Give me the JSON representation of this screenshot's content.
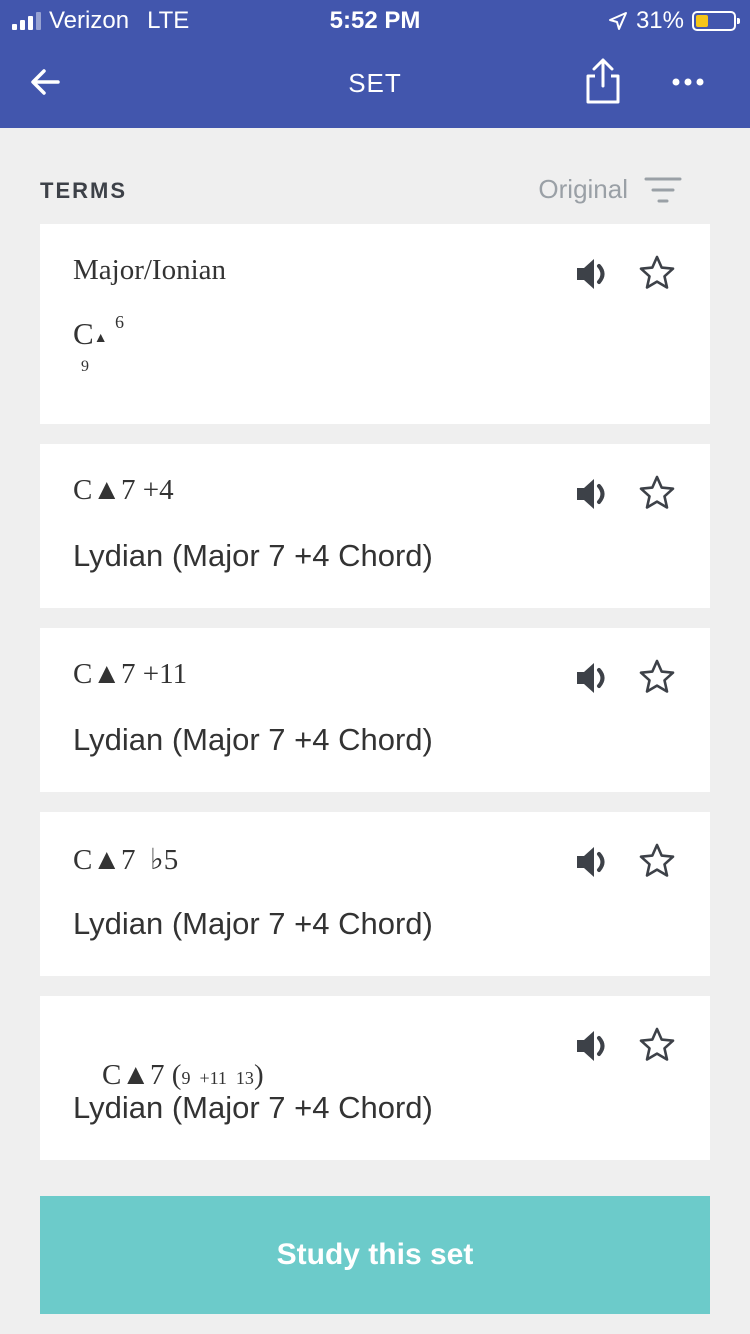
{
  "status_bar": {
    "carrier": "Verizon",
    "network": "LTE",
    "time": "5:52 PM",
    "battery": "31%",
    "battery_level": 0.31
  },
  "nav": {
    "title": "SET",
    "back_icon": "arrow-left-icon",
    "share_icon": "share-icon",
    "more_icon": "more-horizontal-icon"
  },
  "terms_section": {
    "label": "TERMS",
    "sort_label": "Original",
    "sort_icon": "filter-icon"
  },
  "cards": [
    {
      "term": "Major/Ionian",
      "definition_symbol": {
        "c": "C",
        "triangle": "▲",
        "sup": "6",
        "sub": "9"
      }
    },
    {
      "term": "C▲7 +4",
      "definition": "Lydian (Major 7 +4 Chord)"
    },
    {
      "term": "C▲7 +11",
      "definition": "Lydian (Major 7 +4 Chord)"
    },
    {
      "term": "C▲7  ♭5",
      "definition": "Lydian (Major 7 +4 Chord)"
    },
    {
      "term_parts": {
        "base": "C▲7 (",
        "inner": "9  +11  13",
        "close": ")"
      },
      "definition": "Lydian (Major 7 +4 Chord)"
    }
  ],
  "study_button": {
    "label": "Study this set"
  },
  "colors": {
    "header": "#4256ad",
    "background": "#efefef",
    "card": "#ffffff",
    "study_button": "#6ccbca",
    "text": "#333333",
    "muted": "#9aa0a6",
    "icon": "#3d4148"
  }
}
